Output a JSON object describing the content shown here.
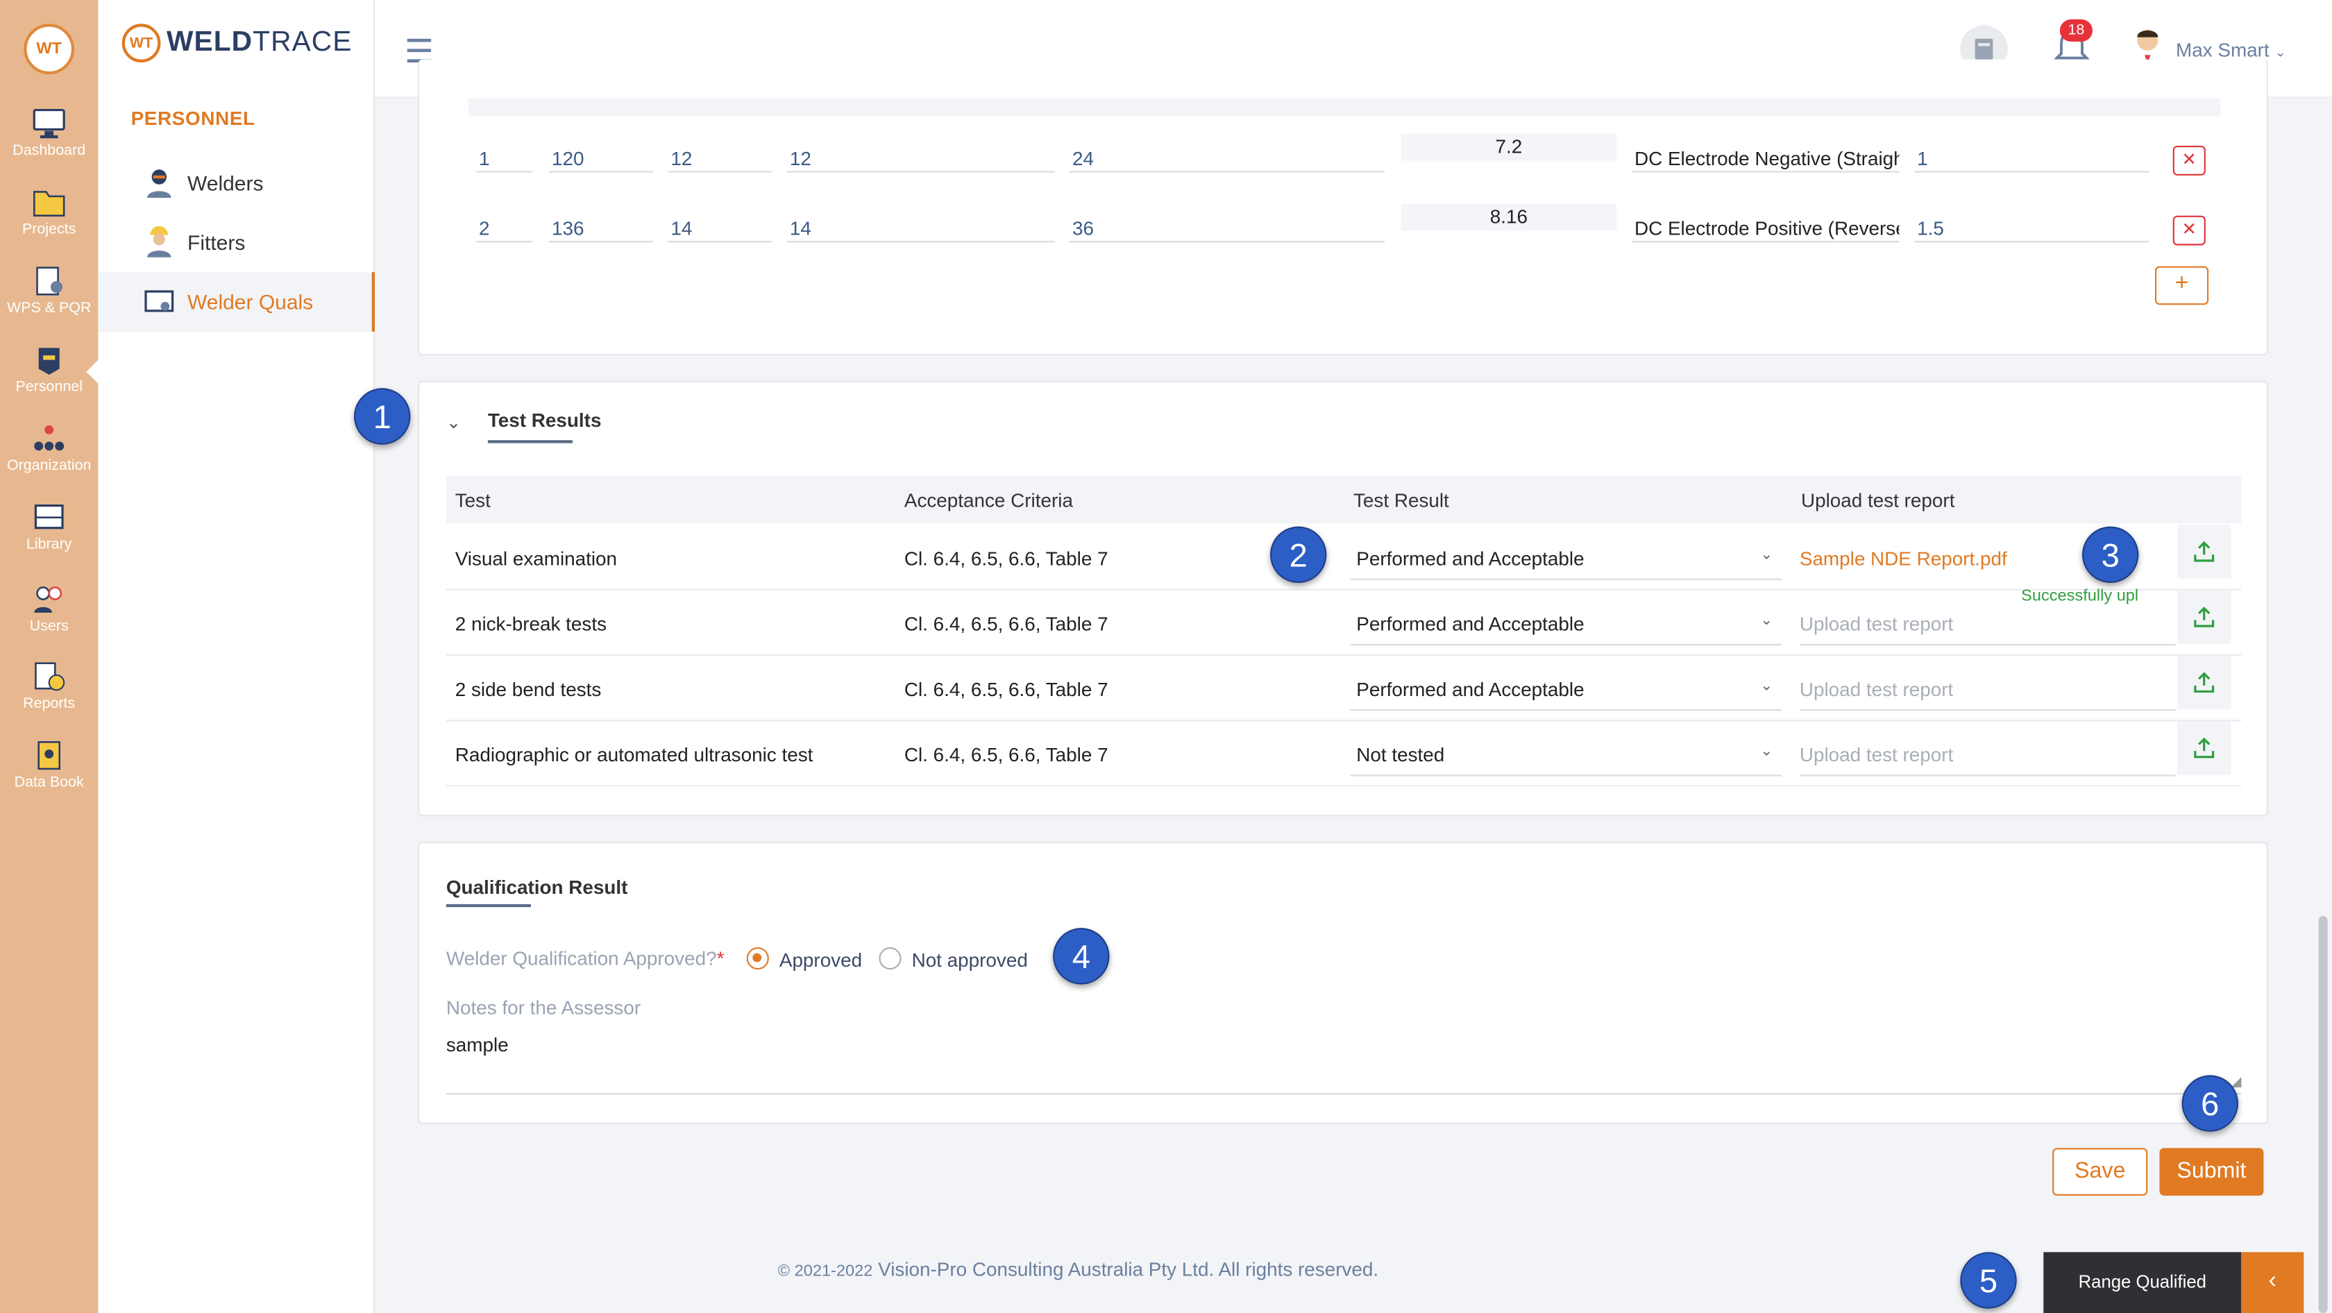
{
  "app": {
    "brand_prefix": "WELD",
    "brand_suffix": "TRACE",
    "logo_text": "WT"
  },
  "rail": [
    {
      "label": "Dashboard",
      "icon": "monitor-icon"
    },
    {
      "label": "Projects",
      "icon": "folder-icon"
    },
    {
      "label": "WPS & PQR",
      "icon": "clipboard-gear-icon"
    },
    {
      "label": "Personnel",
      "icon": "welder-mask-icon"
    },
    {
      "label": "Organization",
      "icon": "org-chart-icon"
    },
    {
      "label": "Library",
      "icon": "book-icon"
    },
    {
      "label": "Users",
      "icon": "users-icon"
    },
    {
      "label": "Reports",
      "icon": "report-clock-icon"
    },
    {
      "label": "Data Book",
      "icon": "data-book-icon"
    }
  ],
  "subnav": {
    "section": "PERSONNEL",
    "items": [
      {
        "label": "Welders",
        "icon": "welder-icon"
      },
      {
        "label": "Fitters",
        "icon": "fitter-icon"
      },
      {
        "label": "Welder Quals",
        "icon": "certificate-icon"
      }
    ]
  },
  "topbar": {
    "notifications": "18",
    "user": "Max Smart"
  },
  "passes": [
    {
      "seq": "1",
      "amps": "120",
      "volts": "12",
      "travel": "12",
      "wire": "24",
      "heat": "7.2",
      "current": "DC Electrode Negative (Straight",
      "time": "1"
    },
    {
      "seq": "2",
      "amps": "136",
      "volts": "14",
      "travel": "14",
      "wire": "36",
      "heat": "8.16",
      "current": "DC Electrode Positive (Reverse",
      "time": "1.5"
    }
  ],
  "test_results": {
    "title": "Test Results",
    "columns": {
      "test": "Test",
      "criteria": "Acceptance Criteria",
      "result": "Test Result",
      "upload": "Upload test report"
    },
    "rows": [
      {
        "test": "Visual examination",
        "criteria": "Cl. 6.4, 6.5, 6.6, Table 7",
        "result": "Performed and Acceptable",
        "upload": "Sample NDE Report.pdf"
      },
      {
        "test": "2 nick-break tests",
        "criteria": "Cl. 6.4, 6.5, 6.6, Table 7",
        "result": "Performed and Acceptable",
        "upload": "Upload test report"
      },
      {
        "test": "2 side bend tests",
        "criteria": "Cl. 6.4, 6.5, 6.6, Table 7",
        "result": "Performed and Acceptable",
        "upload": "Upload test report"
      },
      {
        "test": "Radiographic or automated ultrasonic test",
        "criteria": "Cl. 6.4, 6.5, 6.6, Table 7",
        "result": "Not tested",
        "upload": "Upload test report"
      }
    ],
    "upload_status": "Successfully upl"
  },
  "qualification": {
    "title": "Qualification Result",
    "question": "Welder Qualification Approved?",
    "required_mark": "*",
    "option_approved": "Approved",
    "option_not_approved": "Not approved",
    "selected": "Approved",
    "notes_label": "Notes for the Assessor",
    "notes_value": "sample"
  },
  "actions": {
    "save": "Save",
    "submit": "Submit"
  },
  "footer": {
    "years": "© 2021-2022",
    "company": "Vision-Pro Consulting Australia Pty Ltd. All rights reserved."
  },
  "range_panel": {
    "label": "Range Qualified",
    "toggle": "‹"
  },
  "markers": [
    "1",
    "2",
    "3",
    "4",
    "5",
    "6"
  ],
  "colors": {
    "accent": "#e07a23",
    "rail": "#e7b88f",
    "marker": "#2d5ec5",
    "danger": "#e0343a",
    "success": "#2e9e3e"
  }
}
